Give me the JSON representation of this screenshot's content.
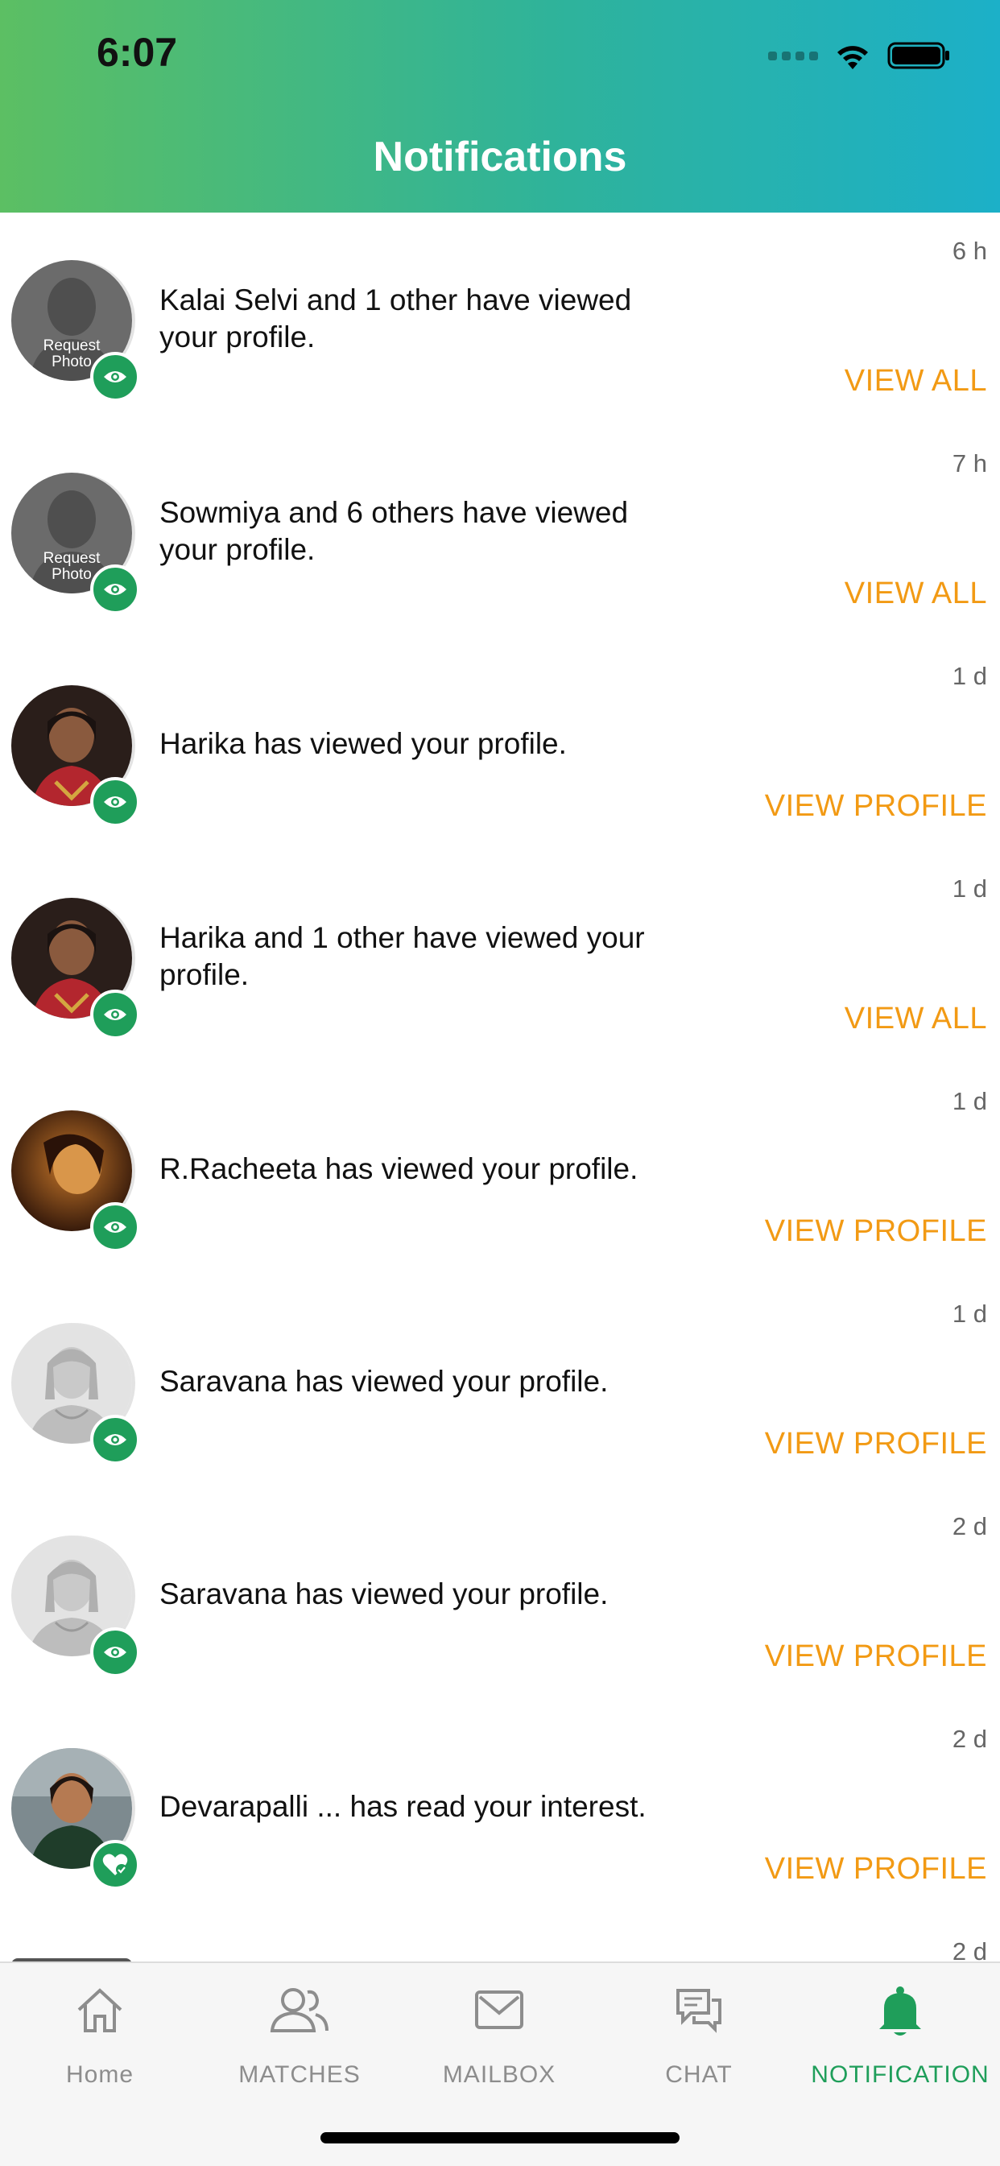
{
  "status_bar": {
    "time": "6:07"
  },
  "header": {
    "title": "Notifications"
  },
  "notifications": [
    {
      "avatar": "request-photo",
      "message": "Kalai Selvi and 1 other have viewed your profile.",
      "time": "6 h",
      "action": "VIEW ALL",
      "badge_icon": "eye-icon"
    },
    {
      "avatar": "request-photo",
      "message": "Sowmiya and 6 others have viewed your profile.",
      "time": "7 h",
      "action": "VIEW ALL",
      "badge_icon": "eye-icon"
    },
    {
      "avatar": "photo",
      "message": "Harika has viewed your profile.",
      "time": "1 d",
      "action": "VIEW PROFILE",
      "badge_icon": "eye-icon"
    },
    {
      "avatar": "photo",
      "message": "Harika and 1 other have viewed your profile.",
      "time": "1 d",
      "action": "VIEW ALL",
      "badge_icon": "eye-icon"
    },
    {
      "avatar": "photo-dark",
      "message": "R.Racheeta has viewed your profile.",
      "time": "1 d",
      "action": "VIEW PROFILE",
      "badge_icon": "eye-icon"
    },
    {
      "avatar": "placeholder",
      "message": "Saravana has viewed your profile.",
      "time": "1 d",
      "action": "VIEW PROFILE",
      "badge_icon": "eye-icon"
    },
    {
      "avatar": "placeholder",
      "message": "Saravana has viewed your profile.",
      "time": "2 d",
      "action": "VIEW PROFILE",
      "badge_icon": "eye-icon"
    },
    {
      "avatar": "photo-green",
      "message": "Devarapalli ... has read your interest.",
      "time": "2 d",
      "action": "VIEW PROFILE",
      "badge_icon": "heart-check-icon"
    }
  ],
  "partial_item": {
    "time": "2 d"
  },
  "avatar_text": {
    "request_photo_line1": "Request",
    "request_photo_line2": "Photo"
  },
  "tabbar": {
    "tabs": [
      {
        "label": "Home",
        "icon": "home-icon"
      },
      {
        "label": "MATCHES",
        "icon": "users-icon"
      },
      {
        "label": "MAILBOX",
        "icon": "mail-icon"
      },
      {
        "label": "CHAT",
        "icon": "chat-icon"
      },
      {
        "label": "NOTIFICATION",
        "icon": "bell-icon",
        "active": true
      }
    ]
  },
  "colors": {
    "accent": "#1f9e5a",
    "action": "#f29a14",
    "header_start": "#5cbf63",
    "header_end": "#1cb0c8"
  }
}
